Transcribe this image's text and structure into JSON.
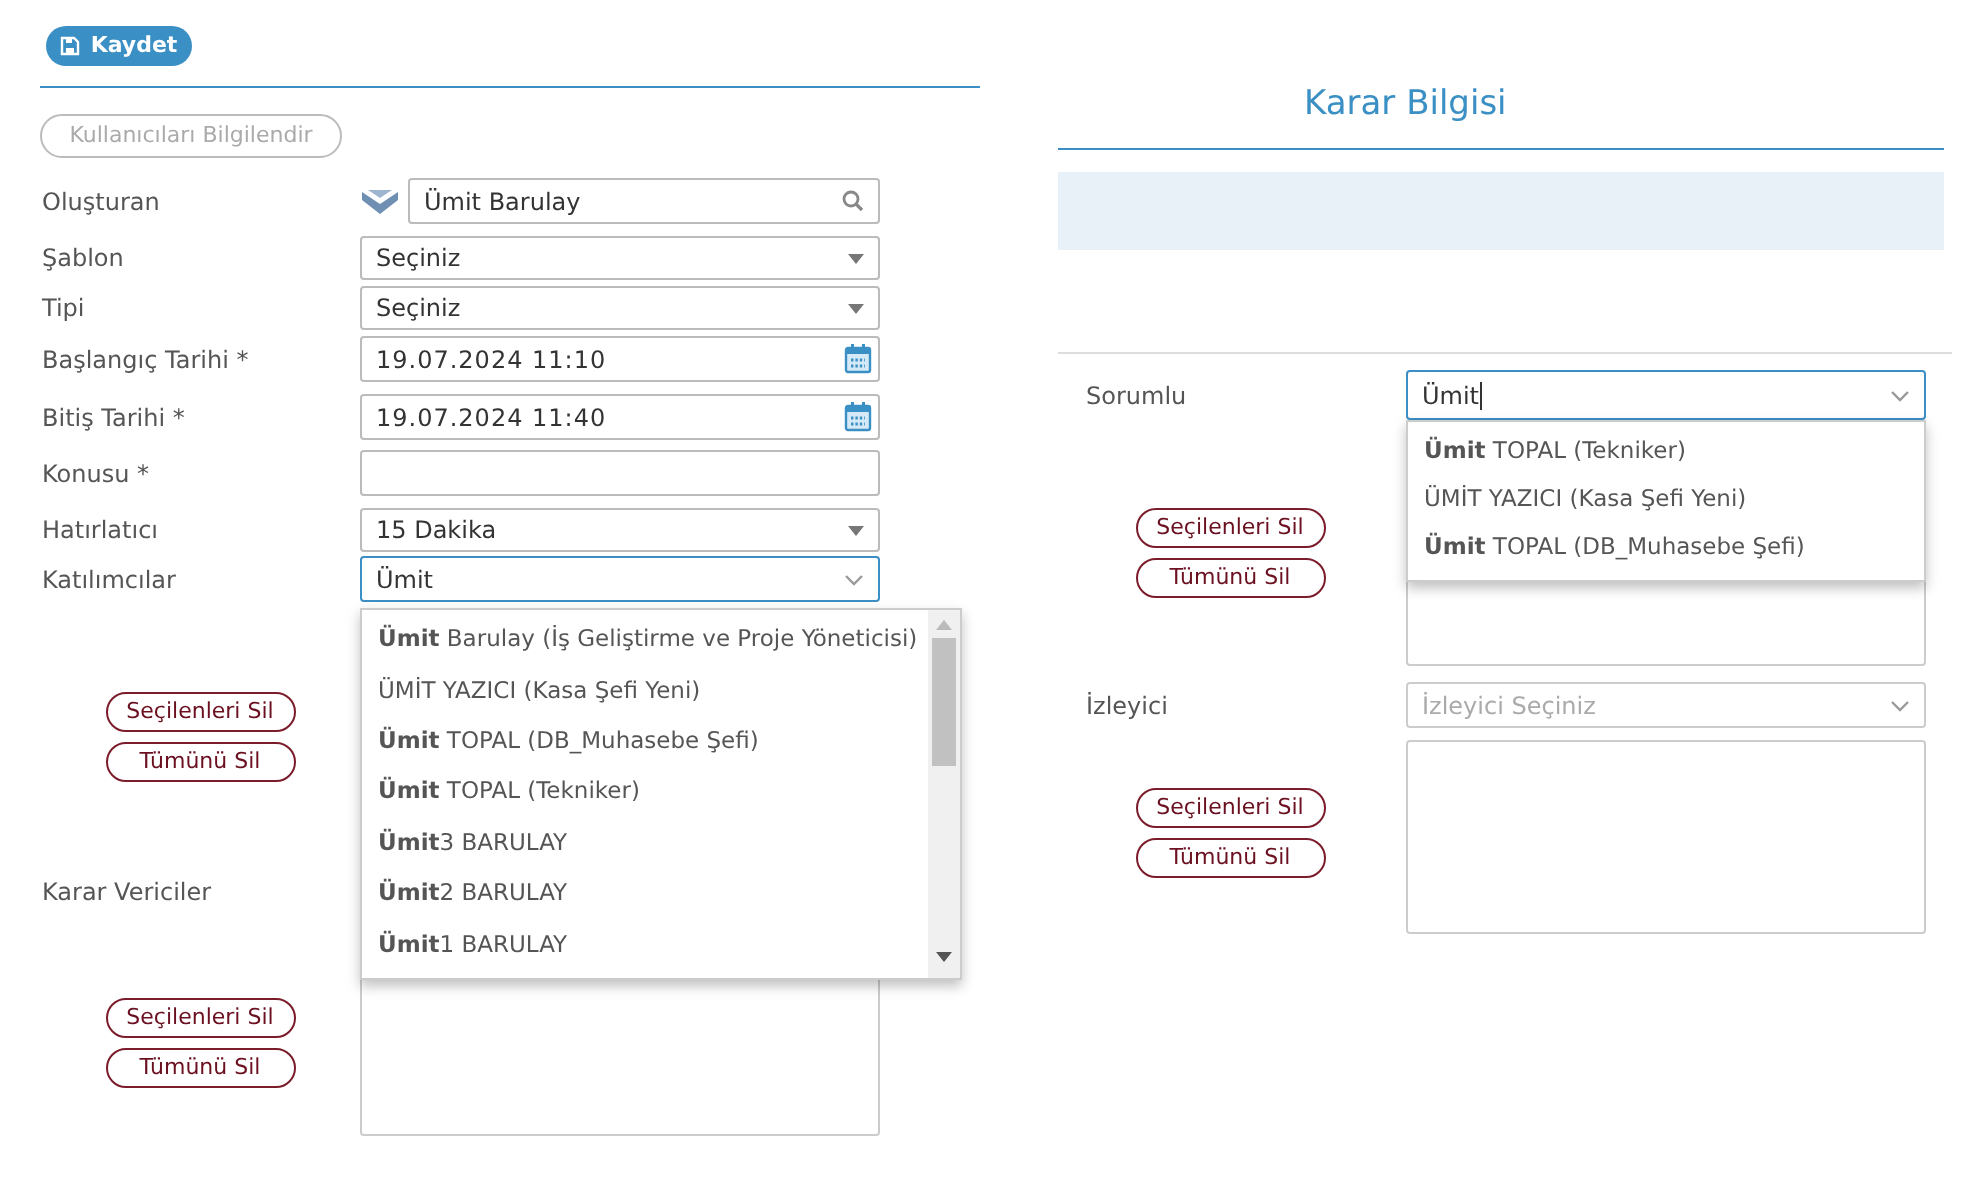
{
  "toolbar": {
    "save_label": "Kaydet"
  },
  "notify_button": "Kullanıcıları Bilgilendir",
  "form": [
    {
      "label": "Oluşturan",
      "kind": "lookup",
      "value": "Ümit Barulay"
    },
    {
      "label": "Şablon",
      "kind": "select",
      "value": "Seçiniz"
    },
    {
      "label": "Tipi",
      "kind": "select",
      "value": "Seçiniz"
    },
    {
      "label": "Başlangıç Tarihi *",
      "kind": "date",
      "value": "19.07.2024 11:10"
    },
    {
      "label": "Bitiş Tarihi *",
      "kind": "date",
      "value": "19.07.2024 11:40"
    },
    {
      "label": "Konusu *",
      "kind": "text"
    },
    {
      "label": "Hatırlatıcı",
      "kind": "select",
      "value": "15 Dakika"
    },
    {
      "label": "Katılımcılar",
      "kind": "combo",
      "value": "Ümit",
      "focused": true
    }
  ],
  "participants": {
    "buttons": [
      "Seçilenleri Sil",
      "Tümünü Sil"
    ],
    "dropdown": [
      "**Ümit** Barulay (İş Geliştirme ve Proje Yöneticisi)",
      "ÜMİT YAZICI (Kasa Şefi Yeni)",
      "**Ümit** TOPAL (DB_Muhasebe Şefi)",
      "**Ümit** TOPAL (Tekniker)",
      "**Ümit**3 BARULAY",
      "**Ümit**2 BARULAY",
      "**Ümit**1 BARULAY"
    ]
  },
  "decision_makers": {
    "label": "Karar Vericiler",
    "buttons": [
      "Seçilenleri Sil",
      "Tümünü Sil"
    ]
  },
  "decision_info": {
    "title": "Karar Bilgisi"
  },
  "responsible": {
    "label": "Sorumlu",
    "value": "Ümit",
    "focused": true,
    "buttons": [
      "Seçilenleri Sil",
      "Tümünü Sil"
    ],
    "dropdown": [
      "**Ümit** TOPAL (Tekniker)",
      "ÜMİT YAZICI (Kasa Şefi Yeni)",
      "**Ümit** TOPAL (DB_Muhasebe Şefi)"
    ]
  },
  "watcher": {
    "label": "İzleyici",
    "placeholder": "İzleyici Seçiniz",
    "buttons": [
      "Seçilenleri Sil",
      "Tümünü Sil"
    ]
  }
}
